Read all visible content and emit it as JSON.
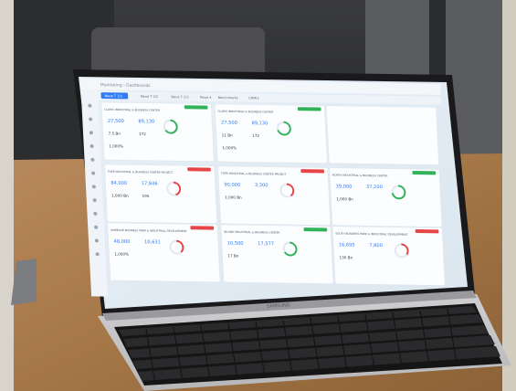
{
  "screen": {
    "breadcrumb": [
      "Monitoring",
      "Dashboards"
    ],
    "tabs": [
      "Neue T 1/3",
      "Neue T 2/2",
      "Neue T 2/3",
      "Neue 4",
      "Benchmarks",
      "CRM/3"
    ],
    "active_tab": 0,
    "accent_color": "#2f7cf6",
    "badge_green": "#32b35a",
    "badge_red": "#e74646",
    "cards": [
      {
        "row": 0,
        "col": 0,
        "status": "ok",
        "title": "CLARIS INDUSTRIAL & BUSINESS CENTER",
        "metrics": [
          "27,500",
          "89,130",
          "7.5 Bn",
          "172",
          "1,000%"
        ],
        "gauge": 65
      },
      {
        "row": 0,
        "col": 1,
        "status": "ok",
        "title": "CLARIS INDUSTRIAL & BUSINESS CENTER",
        "metrics": [
          "27,500",
          "89,130",
          "11 Bn",
          "172",
          "1,000%"
        ],
        "gauge": 70
      },
      {
        "row": 0,
        "col": 2,
        "status": "none",
        "title": "",
        "metrics": [],
        "gauge": 0
      },
      {
        "row": 1,
        "col": 0,
        "status": "alert",
        "title": "TOPE INDUSTRIAL & BUSINESS CENTER PROJECT",
        "metrics": [
          "84,000",
          "17,846",
          "1,000 Bn",
          "195"
        ],
        "gauge": 45
      },
      {
        "row": 1,
        "col": 1,
        "status": "alert",
        "title": "TOPE INDUSTRIAL & BUSINESS CENTER PROJECT",
        "metrics": [
          "90,000",
          "3,300",
          "1,000 Bn"
        ],
        "gauge": 40
      },
      {
        "row": 1,
        "col": 2,
        "status": "ok",
        "title": "NORTH INDUSTRIAL & BUSINESS CENTER",
        "metrics": [
          "39,000",
          "37,200",
          "1,000 Bn"
        ],
        "gauge": 72
      },
      {
        "row": 2,
        "col": 0,
        "status": "alert",
        "title": "HARBOUR BUSINESS PARK & INDUSTRIAL DEVELOPMENT",
        "metrics": [
          "48,000",
          "10,631",
          "1,000%"
        ],
        "gauge": 38
      },
      {
        "row": 2,
        "col": 1,
        "status": "ok",
        "title": "INLAND INDUSTRIAL & BUSINESS CENTER",
        "metrics": [
          "10,500",
          "17,577",
          "17 Bn"
        ],
        "gauge": 66
      },
      {
        "row": 2,
        "col": 2,
        "status": "alert",
        "title": "SOUTH BUSINESS PARK & INDUSTRIAL DEVELOPMENT",
        "metrics": [
          "16,695",
          "7,800",
          "130 Bn"
        ],
        "gauge": 35
      }
    ]
  },
  "laptop": {
    "brand": "SAMSUNG"
  }
}
